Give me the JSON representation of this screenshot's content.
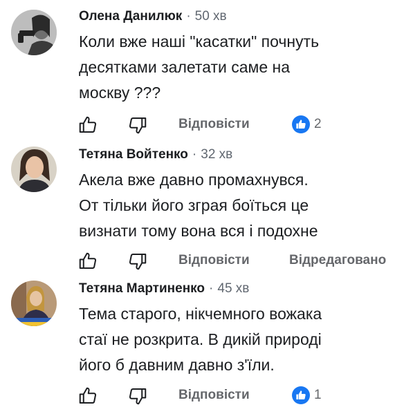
{
  "comments": [
    {
      "author": "Олена Данилюк",
      "time": "50 хв",
      "lines": [
        "Коли вже наші \"касатки\" почнуть",
        "десятками залетати саме на",
        "москву ???"
      ],
      "reply_label": "Відповісти",
      "like_count": "2",
      "avatar_icon": "avatar-woman-with-gun"
    },
    {
      "author": "Тетяна Войтенко",
      "time": "32 хв",
      "lines": [
        "Акела вже давно промахнувся.",
        "От тільки його зграя боїться це",
        "визнати тому вона вся і подохне"
      ],
      "reply_label": "Відповісти",
      "edited_label": "Відредаговано",
      "avatar_icon": "avatar-woman-portrait"
    },
    {
      "author": "Тетяна Мартиненко",
      "time": "45 хв",
      "lines": [
        "Тема старого, нікчемного вожака",
        "стаї не розкрита. В дикій природі",
        "його б давним давно з'їли."
      ],
      "reply_label": "Відповісти",
      "like_count": "1",
      "avatar_icon": "avatar-woman-room"
    }
  ],
  "icons": {
    "like": "thumbs-up-icon",
    "dislike": "thumbs-down-icon",
    "reaction": "like-reaction-icon"
  },
  "colors": {
    "text": "#1c1e21",
    "secondary": "#65676b",
    "like_blue": "#1877f2"
  }
}
